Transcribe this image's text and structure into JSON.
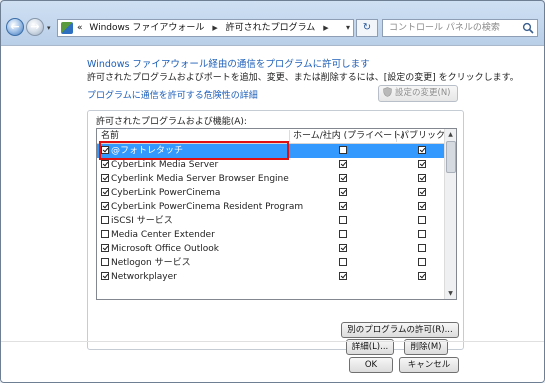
{
  "address_bar": {
    "breadcrumb_lead": "«",
    "crumb_1": "Windows ファイアウォール",
    "crumb_2": "許可されたプログラム",
    "search_placeholder": "コントロール パネルの検索"
  },
  "main": {
    "heading": "Windows ファイアウォール経由の通信をプログラムに許可します",
    "description": "許可されたプログラムおよびポートを追加、変更、または削除するには、[設定の変更] をクリックします。",
    "risk_link": "プログラムに通信を許可する危険性の詳細",
    "change_settings_button": "設定の変更(N)",
    "group_label": "許可されたプログラムおよび機能(A):"
  },
  "table": {
    "columns": [
      "名前",
      "ホーム/社内 (プライベート)",
      "パブリック"
    ],
    "rows": [
      {
        "name": "@フォトレタッチ",
        "enabled": true,
        "home": false,
        "public": true,
        "selected": true
      },
      {
        "name": "CyberLink Media Server",
        "enabled": true,
        "home": true,
        "public": true,
        "selected": false
      },
      {
        "name": "Cyberlink Media Server Browser Engine",
        "enabled": true,
        "home": true,
        "public": true,
        "selected": false
      },
      {
        "name": "CyberLink PowerCinema",
        "enabled": true,
        "home": true,
        "public": true,
        "selected": false
      },
      {
        "name": "CyberLink PowerCinema Resident Program",
        "enabled": true,
        "home": true,
        "public": true,
        "selected": false
      },
      {
        "name": "iSCSI サービス",
        "enabled": false,
        "home": false,
        "public": false,
        "selected": false
      },
      {
        "name": "Media Center Extender",
        "enabled": false,
        "home": false,
        "public": false,
        "selected": false
      },
      {
        "name": "Microsoft Office Outlook",
        "enabled": true,
        "home": true,
        "public": false,
        "selected": false
      },
      {
        "name": "Netlogon サービス",
        "enabled": false,
        "home": false,
        "public": false,
        "selected": false
      },
      {
        "name": "Networkplayer",
        "enabled": true,
        "home": true,
        "public": true,
        "selected": false
      }
    ]
  },
  "buttons": {
    "details": "詳細(L)...",
    "remove": "削除(M)",
    "allow_other": "別のプログラムの許可(R)...",
    "ok": "OK",
    "cancel": "キャンセル"
  },
  "colors": {
    "link": "#1d5fb8",
    "selection": "#3399ff",
    "highlight_frame": "#e01010"
  },
  "icons": [
    "back-arrow-icon",
    "forward-arrow-icon",
    "control-panel-icon",
    "refresh-icon",
    "search-icon",
    "shield-icon"
  ]
}
